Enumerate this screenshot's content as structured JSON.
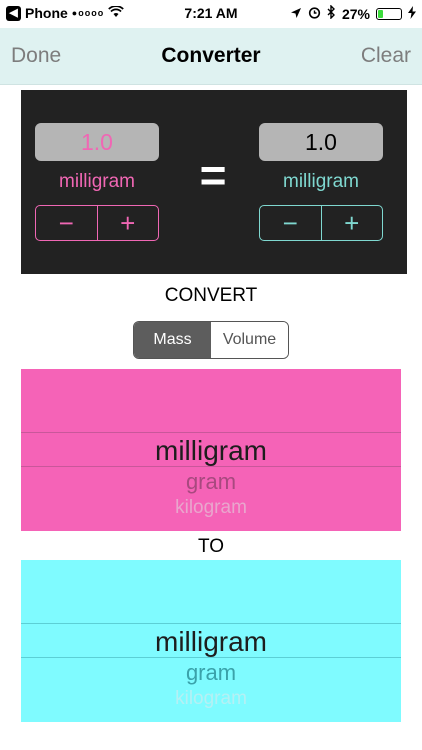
{
  "status_bar": {
    "back_app": "Phone",
    "signal": "●oooo",
    "time": "7:21 AM",
    "battery": "27%",
    "battery_level": 0.27
  },
  "nav": {
    "done": "Done",
    "title": "Converter",
    "clear": "Clear"
  },
  "converter": {
    "left": {
      "value": "1.0",
      "unit": "milligram"
    },
    "equals": "=",
    "right": {
      "value": "1.0",
      "unit": "milligram"
    },
    "minus": "−",
    "plus": "+"
  },
  "convert_label": "CONVERT",
  "segments": {
    "mass": "Mass",
    "volume": "Volume",
    "selected": "Mass"
  },
  "from_picker": {
    "selected": "milligram",
    "next": "gram",
    "far": "kilogram"
  },
  "to_label": "TO",
  "to_picker": {
    "selected": "milligram",
    "next": "gram",
    "far": "kilogram"
  },
  "colors": {
    "pink": "#f563b7",
    "cyan": "#7ffbff",
    "panel": "#222222",
    "nav_bg": "#dff2f1"
  }
}
